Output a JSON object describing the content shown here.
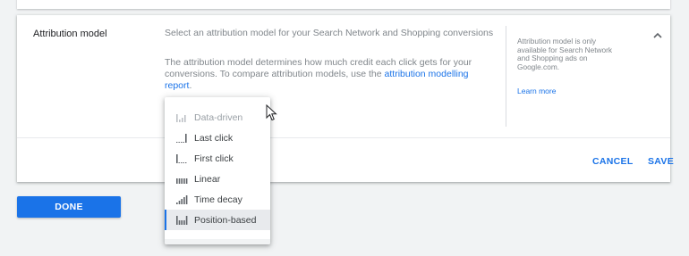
{
  "section": {
    "title": "Attribution model",
    "description_line1": "Select an attribution model for your Search Network and Shopping conversions",
    "description_line2": "The attribution model determines how much credit each click gets for your conversions. To compare attribution models, use the ",
    "description_link": "attribution modelling report",
    "description_end": ".",
    "side_note": "Attribution model is only available for Search Network and Shopping ads on Google.com.",
    "learn_more": "Learn more",
    "collapse_icon": "chevron-up-icon",
    "cancel_label": "CANCEL",
    "save_label": "SAVE"
  },
  "dropdown": {
    "items": [
      {
        "label": "Data-driven",
        "icon": "data-driven-icon",
        "disabled": true
      },
      {
        "label": "Last click",
        "icon": "last-click-icon"
      },
      {
        "label": "First click",
        "icon": "first-click-icon"
      },
      {
        "label": "Linear",
        "icon": "linear-icon"
      },
      {
        "label": "Time decay",
        "icon": "time-decay-icon"
      },
      {
        "label": "Position-based",
        "icon": "position-based-icon",
        "selected": true
      }
    ]
  },
  "done_label": "DONE",
  "colors": {
    "accent": "#1a73e8",
    "background": "#f1f3f4",
    "card": "#ffffff",
    "muted_text": "#80868b"
  }
}
